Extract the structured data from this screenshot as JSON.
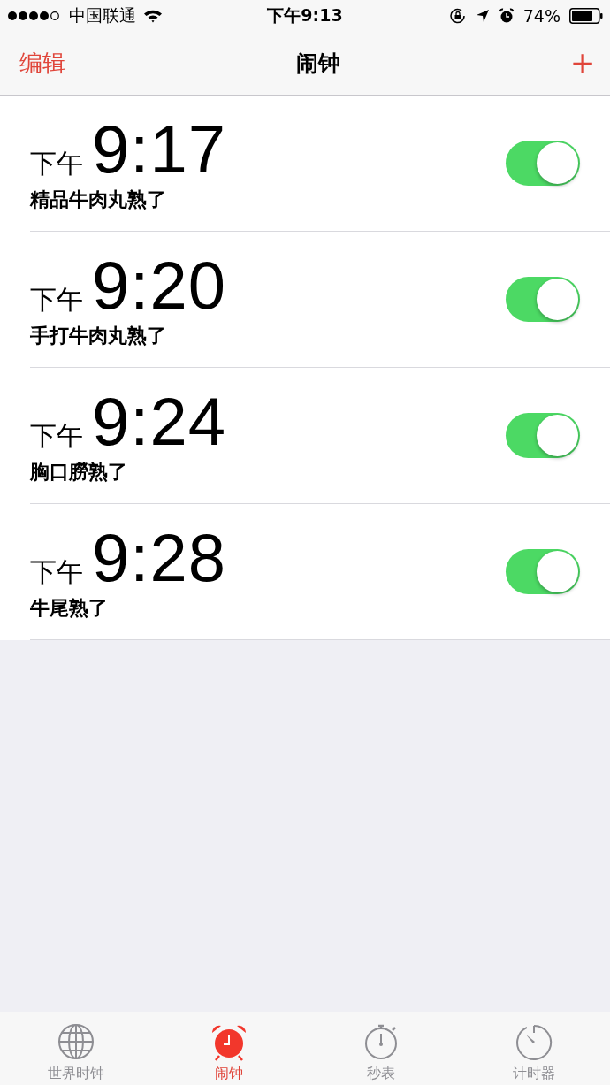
{
  "status_bar": {
    "carrier": "中国联通",
    "time": "下午9:13",
    "battery": "74%"
  },
  "nav": {
    "edit": "编辑",
    "title": "闹钟",
    "add": "+"
  },
  "alarms": [
    {
      "period": "下午",
      "time": "9:17",
      "label": "精品牛肉丸熟了",
      "on": true
    },
    {
      "period": "下午",
      "time": "9:20",
      "label": "手打牛肉丸熟了",
      "on": true
    },
    {
      "period": "下午",
      "time": "9:24",
      "label": "胸口朥熟了",
      "on": true
    },
    {
      "period": "下午",
      "time": "9:28",
      "label": "牛尾熟了",
      "on": true
    }
  ],
  "tabs": [
    {
      "kind": "globe",
      "label": "世界时钟",
      "selected": false
    },
    {
      "kind": "alarm",
      "label": "闹钟",
      "selected": true
    },
    {
      "kind": "stopwatch",
      "label": "秒表",
      "selected": false
    },
    {
      "kind": "timer",
      "label": "计时器",
      "selected": false
    }
  ]
}
